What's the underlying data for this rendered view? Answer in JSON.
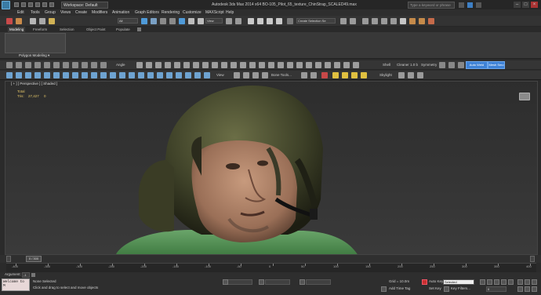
{
  "titlebar": {
    "workspace": "Workspace: Default",
    "title": "Autodesk 3ds Max 2014 x64    BO-105_Pilot_65_texture_ChinStrap_SCALED49.max",
    "search_placeholder": "Type a keyword or phrase",
    "minimize": "–",
    "maximize": "□",
    "close": "×"
  },
  "menu": [
    "Edit",
    "Tools",
    "Group",
    "Views",
    "Create",
    "Modifiers",
    "Animation",
    "Graph Editors",
    "Rendering",
    "Customize",
    "MAXScript",
    "Help"
  ],
  "toolbar1": {
    "selection_filter": "All",
    "view_dropdown": "View",
    "named_selection": "Create Selection Se"
  },
  "ribbon": {
    "tabs": [
      {
        "label": "Modeling",
        "active": true
      },
      {
        "label": "Freeform",
        "active": false
      },
      {
        "label": "Selection",
        "active": false
      },
      {
        "label": "Object Paint",
        "active": false
      },
      {
        "label": "Populate",
        "active": false
      }
    ],
    "panel_label": "Polygon Modeling ▾"
  },
  "toolbar2": {
    "angle": "Angle",
    "shell": "Shell",
    "cleaner": "Cleaner 1.0 b",
    "symmetry": "Symmetry",
    "auto_weld": "Auto Weld",
    "mesh_smooth": "Mesh Smo"
  },
  "toolbar3": {
    "view": "View",
    "bone_tools": "Bone Tools...",
    "skylight": "Skylight"
  },
  "viewport": {
    "label": "[ + ] [ Perspective ] [ Shaded ]",
    "stats_total": "Total",
    "stats_tris_label": "Tris:",
    "stats_tris_value": "27,427",
    "stats_sel_value": "0"
  },
  "timeline": {
    "slider": "0 / 300",
    "ticks": [
      "-400",
      "-350",
      "-300",
      "-250",
      "-200",
      "-150",
      "-100",
      "-50",
      "0",
      "50",
      "100",
      "150",
      "200",
      "250",
      "300",
      "350",
      "400"
    ]
  },
  "status": {
    "maxscript_text": "Welcome to M",
    "argument_label": "Argument:",
    "argument_value": "-1",
    "selection": "None Selected",
    "prompt": "Click and drag to select and move objects",
    "grid": "Grid = 10.0m",
    "add_time_tag": "Add Time Tag",
    "auto_key": "Auto Key",
    "auto_key_value": "Selected",
    "set_key": "Set Key",
    "key_filters": "Key Filters...",
    "frame": "0"
  }
}
